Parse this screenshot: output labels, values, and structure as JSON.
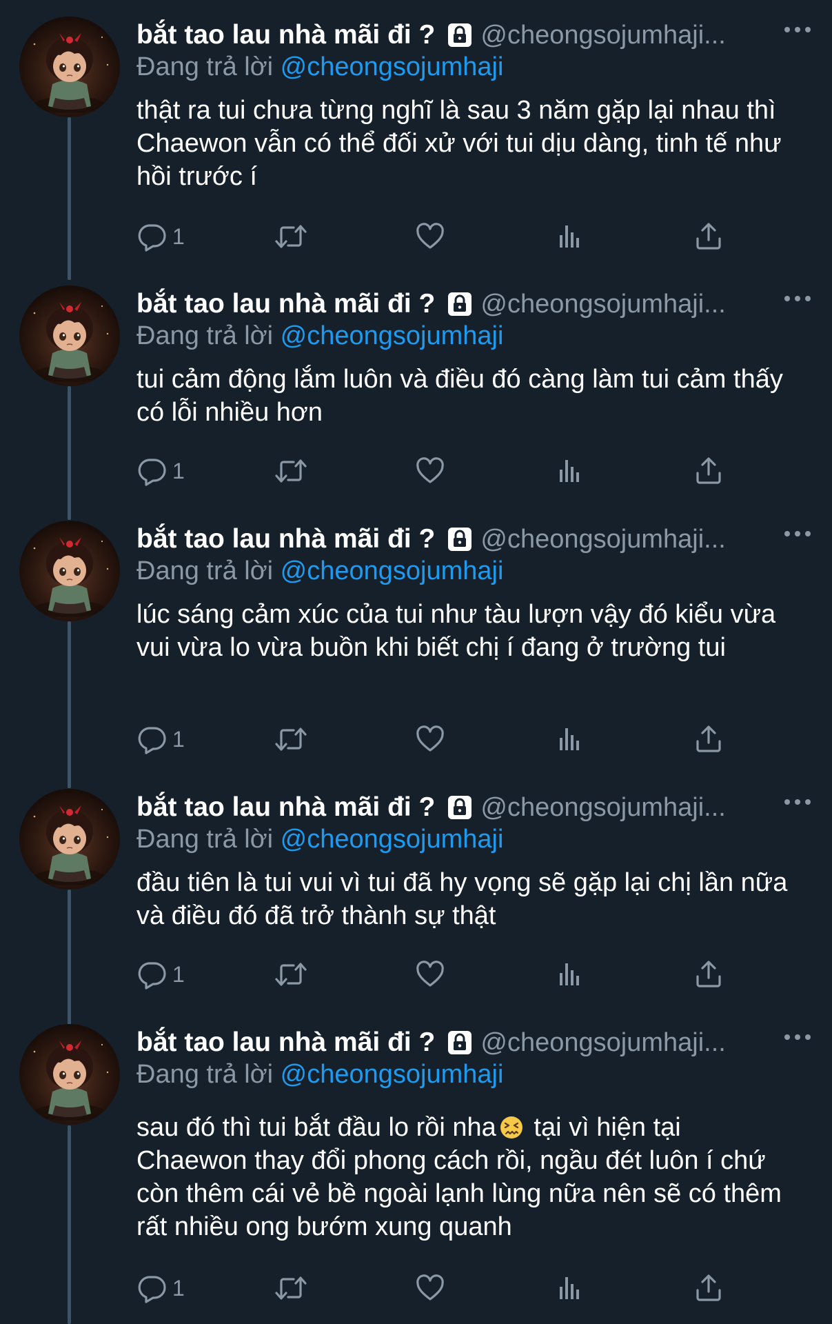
{
  "theme": {
    "background": "#15202b",
    "text": "#ffffff",
    "muted": "#8b98a5",
    "link": "#1d9bf0",
    "thread_line": "#3d5466"
  },
  "tweets": [
    {
      "display_name": "bắt tao lau nhà mãi đi ?",
      "handle": "@cheongsojumhaji...",
      "reply_prefix": "Đang trả lời",
      "reply_to": "@cheongsojumhaji",
      "text": "thật ra tui chưa từng nghĩ là sau 3 năm gặp lại nhau thì Chaewon vẫn có thể đối xử với tui dịu dàng, tinh tế như hồi trước í",
      "reply_count": "1"
    },
    {
      "display_name": "bắt tao lau nhà mãi đi ?",
      "handle": "@cheongsojumhaji...",
      "reply_prefix": "Đang trả lời",
      "reply_to": "@cheongsojumhaji",
      "text": "tui cảm động lắm luôn và điều đó càng làm tui cảm thấy có lỗi nhiều hơn",
      "reply_count": "1"
    },
    {
      "display_name": "bắt tao lau nhà mãi đi ?",
      "handle": "@cheongsojumhaji...",
      "reply_prefix": "Đang trả lời",
      "reply_to": "@cheongsojumhaji",
      "text": "lúc sáng cảm xúc của tui như tàu lượn vậy đó kiểu vừa vui vừa lo vừa buồn khi biết chị í đang ở trường tui",
      "reply_count": "1"
    },
    {
      "display_name": "bắt tao lau nhà mãi đi ?",
      "handle": "@cheongsojumhaji...",
      "reply_prefix": "Đang trả lời",
      "reply_to": "@cheongsojumhaji",
      "text": "đầu tiên là tui vui vì tui đã hy vọng sẽ gặp lại chị lần nữa và điều đó đã trở thành sự thật",
      "reply_count": "1"
    },
    {
      "display_name": "bắt tao lau nhà mãi đi ?",
      "handle": "@cheongsojumhaji...",
      "reply_prefix": "Đang trả lời",
      "reply_to": "@cheongsojumhaji",
      "text_before_emoji": "sau đó thì tui bắt đầu lo rồi nha",
      "emoji": "confounded-face",
      "text_after_emoji": " tại vì hiện tại Chaewon thay đổi phong cách rồi, ngầu đét luôn  í chứ còn thêm cái vẻ bề ngoài lạnh lùng nữa nên sẽ có thêm rất nhiều ong bướm xung quanh",
      "reply_count": "1"
    }
  ]
}
